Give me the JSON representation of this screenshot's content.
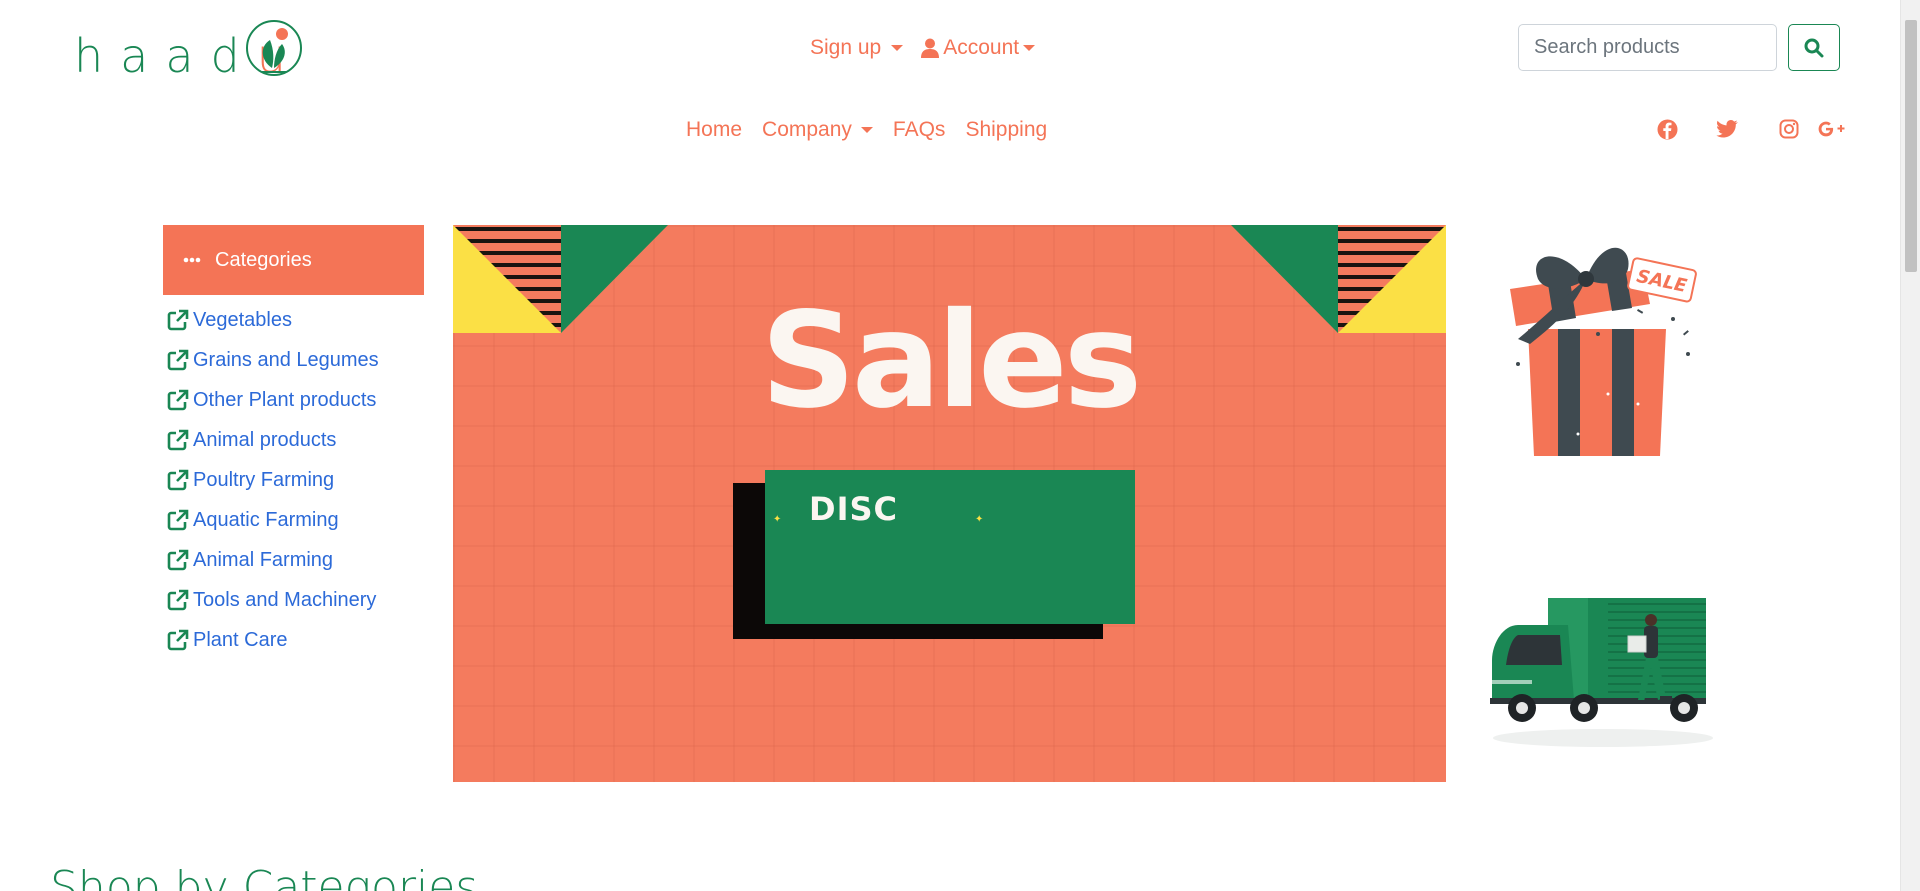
{
  "brand": {
    "name": "haadu",
    "accent_color": "#f47456",
    "green_color": "#1a8754"
  },
  "header": {
    "signup_label": "Sign up",
    "account_label": "Account",
    "search": {
      "placeholder": "Search products",
      "button_icon": "search-icon"
    }
  },
  "nav": {
    "items": [
      {
        "label": "Home"
      },
      {
        "label": "Company",
        "dropdown": true
      },
      {
        "label": "FAQs"
      },
      {
        "label": "Shipping"
      }
    ]
  },
  "social": {
    "icons": [
      "facebook-icon",
      "twitter-icon",
      "instagram-icon",
      "google-plus-icon"
    ]
  },
  "sidebar": {
    "header_label": "Categories",
    "items": [
      {
        "label": "Vegetables"
      },
      {
        "label": "Grains and Legumes"
      },
      {
        "label": "Other Plant products"
      },
      {
        "label": "Animal products"
      },
      {
        "label": "Poultry Farming"
      },
      {
        "label": "Aquatic Farming"
      },
      {
        "label": "Animal Farming"
      },
      {
        "label": "Tools and Machinery"
      },
      {
        "label": "Plant Care"
      }
    ]
  },
  "banner": {
    "title": "Sales",
    "subtitle": "DISC"
  },
  "side_promos": {
    "gift_tag": "SALE"
  },
  "section": {
    "heading": "Shop by Categories"
  }
}
